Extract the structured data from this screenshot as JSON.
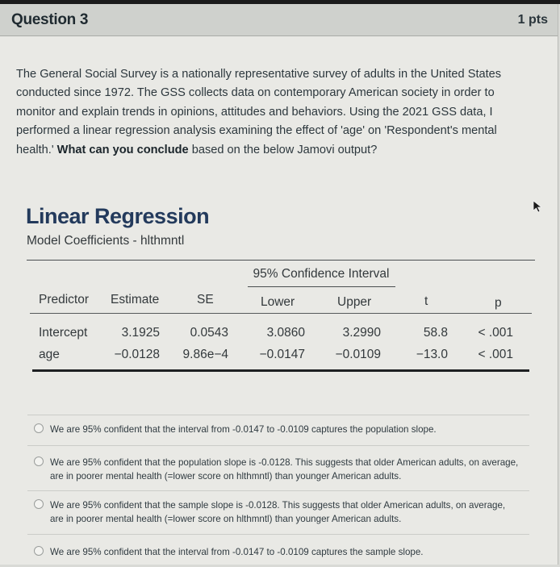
{
  "question": {
    "title": "Question 3",
    "points": "1 pts",
    "prompt_part1": "The General Social Survey is a nationally representative survey of adults in the United States conducted since 1972. The GSS collects data on contemporary American society in order to monitor and explain trends in opinions, attitudes and behaviors. Using the 2021 GSS data, I performed a linear regression analysis examining the effect of 'age' on 'Respondent's mental health.' ",
    "prompt_bold": "What can you conclude",
    "prompt_part2": " based on the below Jamovi output?"
  },
  "jamovi": {
    "title": "Linear Regression",
    "subtitle": "Model Coefficients - hlthmntl",
    "ci_header": "95% Confidence Interval",
    "columns": [
      "Predictor",
      "Estimate",
      "SE",
      "Lower",
      "Upper",
      "t",
      "p"
    ],
    "rows": [
      [
        "Intercept",
        "3.1925",
        "0.0543",
        "3.0860",
        "3.2990",
        "58.8",
        "< .001"
      ],
      [
        "age",
        "−0.0128",
        "9.86e−4",
        "−0.0147",
        "−0.0109",
        "−13.0",
        "< .001"
      ]
    ]
  },
  "answers": [
    {
      "label": "We are 95% confident that the interval from -0.0147 to -0.0109 captures the population slope.",
      "selected": false
    },
    {
      "label": "We are 95% confident that the population slope is -0.0128. This suggests that older American adults, on average, are in poorer mental health (=lower score on hlthmntl) than younger American adults.",
      "selected": false
    },
    {
      "label": "We are 95% confident that the sample slope is -0.0128. This suggests that older American adults, on average, are in poorer mental health (=lower score on hlthmntl) than younger American adults.",
      "selected": false
    },
    {
      "label": "We are 95% confident that the interval from -0.0147 to -0.0109 captures the sample slope.",
      "selected": false
    }
  ],
  "icons": {
    "cursor": "mouse-pointer-icon",
    "radio": "radio-button-icon"
  }
}
